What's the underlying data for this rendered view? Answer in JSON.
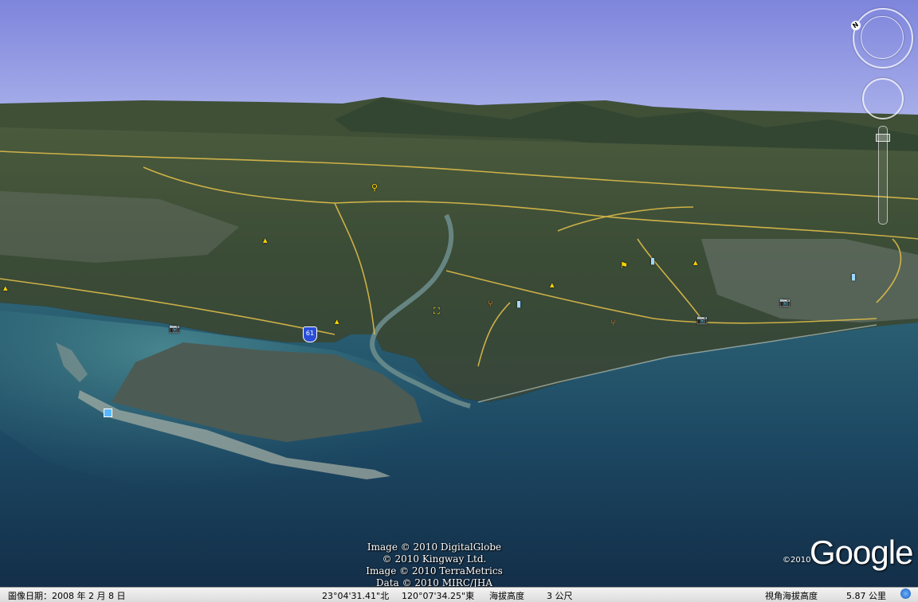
{
  "credits": [
    "Image © 2010 DigitalGlobe",
    "© 2010 Kingway Ltd.",
    "Image © 2010 TerraMetrics",
    "Data © 2010 MIRC/JHA"
  ],
  "logo": {
    "copyright": "©2010",
    "wordmark": "Google"
  },
  "status": {
    "image_date": "圖像日期：2008 年 2 月 8 日",
    "latitude": "23°04'31.41\"北",
    "longitude": "120°07'34.25\"東",
    "elevation_label": "海拔高度",
    "elevation_value": "3 公尺",
    "eye_alt_label": "視角海拔高度",
    "eye_alt_value": "5.87 公里"
  },
  "nav": {
    "north_label": "N"
  },
  "markers": {
    "highway_shield": "61"
  },
  "icons": [
    "north-compass-icon",
    "look-ring-icon",
    "move-ring-icon",
    "zoom-slider-icon",
    "camera-icon",
    "restaurant-icon",
    "lodging-icon",
    "highway-shield-icon"
  ],
  "colors": {
    "sky": "#9aa0e4",
    "sea": "#1a3f5a",
    "land": "#3b4a34",
    "roads": "#e6c24a"
  }
}
